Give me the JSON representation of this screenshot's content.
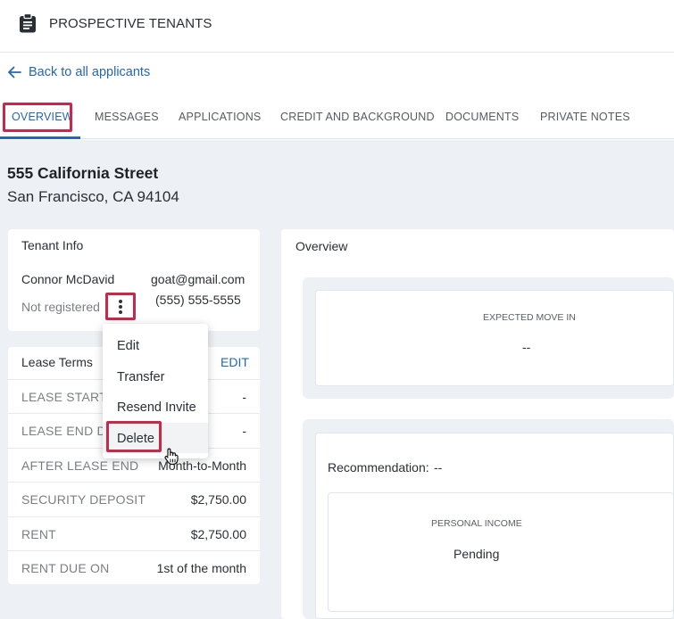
{
  "header": {
    "title": "PROSPECTIVE TENANTS",
    "icon": "clipboard-icon"
  },
  "back_link": {
    "label": "Back to all applicants",
    "icon": "arrow-left-icon"
  },
  "tabs": [
    {
      "label": "OVERVIEW",
      "active": true
    },
    {
      "label": "MESSAGES"
    },
    {
      "label": "APPLICATIONS"
    },
    {
      "label": "CREDIT AND BACKGROUND"
    },
    {
      "label": "DOCUMENTS"
    },
    {
      "label": "PRIVATE NOTES"
    }
  ],
  "address": {
    "line1": "555 California Street",
    "line2": "San Francisco, CA 94104"
  },
  "tenant_info": {
    "title": "Tenant Info",
    "name": "Connor McDavid",
    "email": "goat@gmail.com",
    "status": "Not registered",
    "phone": "(555) 555-5555"
  },
  "lease_terms": {
    "title": "Lease Terms",
    "edit_label": "EDIT",
    "rows": [
      {
        "key": "LEASE START D",
        "value": "-"
      },
      {
        "key": "LEASE END DA",
        "value": "-"
      },
      {
        "key": "AFTER LEASE END",
        "value": "Month-to-Month"
      },
      {
        "key": "SECURITY DEPOSIT",
        "value": "$2,750.00"
      },
      {
        "key": "RENT",
        "value": "$2,750.00"
      },
      {
        "key": "RENT DUE ON",
        "value": "1st of the month"
      }
    ]
  },
  "overview": {
    "title": "Overview",
    "move_in_label": "EXPECTED MOVE IN",
    "move_in_value": "--",
    "recommendation_label": "Recommendation:",
    "recommendation_value": "--",
    "income_label": "PERSONAL INCOME",
    "income_value": "Pending"
  },
  "context_menu": {
    "items": [
      "Edit",
      "Transfer",
      "Resend Invite",
      "Delete"
    ]
  },
  "colors": {
    "accent": "#2666b5",
    "highlight": "#c8294b",
    "background": "#edf0f4"
  }
}
